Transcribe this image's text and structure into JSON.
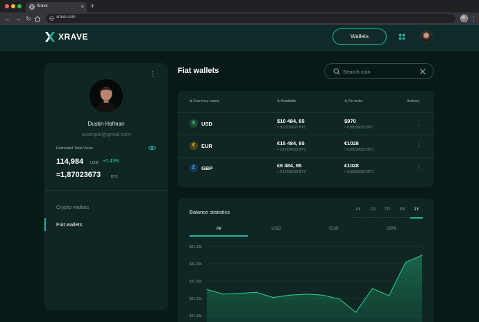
{
  "browser": {
    "tab_title": "Xrave",
    "url": "xrave.com"
  },
  "header": {
    "brand": "XRAVE",
    "wallets_button": "Wallets"
  },
  "profile": {
    "name": "Dustin Hofman",
    "email": "example@gmail.com",
    "estimated_label": "Estimated Total Value",
    "total_value": "114,984",
    "total_unit": "USD",
    "change": "+0.43%",
    "btc_value": "≈1,87023673",
    "btc_unit": "BTC"
  },
  "sidebar_nav": {
    "crypto": "Crypto wallets",
    "fiat": "Fiat wallets"
  },
  "page": {
    "title": "Fiat wallets",
    "search_placeholder": "Search coin"
  },
  "wallet_table": {
    "columns": {
      "currency": "Currency name",
      "available": "Available",
      "on_order": "On order",
      "actions": "Actions"
    },
    "rows": [
      {
        "symbol": "$",
        "code": "USD",
        "available": "$10 484, 85",
        "available_btc": "≈ 0,17230022 BTC",
        "on_order": "$970",
        "on_order_btc": "≈ 0,09230022 BTC",
        "color": "#2f8a4a"
      },
      {
        "symbol": "€",
        "code": "EUR",
        "available": "€15 484, 85",
        "available_btc": "≈ 0,17230022 BTC",
        "on_order": "€1028",
        "on_order_btc": "≈ 0,09230022 BTC",
        "color": "#c9a227"
      },
      {
        "symbol": "£",
        "code": "GBP",
        "available": "£8 484, 85",
        "available_btc": "≈ 0,17230022 BTC",
        "on_order": "£1028",
        "on_order_btc": "≈ 0,09230022 BTC",
        "color": "#2e6fb5"
      }
    ]
  },
  "stats": {
    "title": "Balance statistics",
    "ranges": [
      "All",
      "1D",
      "7D",
      "1M",
      "1Y"
    ],
    "active_range": "1Y",
    "currencies": [
      "All",
      "USD",
      "EUR",
      "GPB"
    ],
    "active_currency": "All"
  },
  "chart_data": {
    "type": "area",
    "y_tick_labels": [
      "$31,35k",
      "$31,35k",
      "$31,35k",
      "$31,35k",
      "$31,35k"
    ],
    "values": [
      0.58,
      0.48,
      0.5,
      0.52,
      0.41,
      0.46,
      0.48,
      0.46,
      0.38,
      0.1,
      0.6,
      0.45,
      1.15,
      1.3
    ],
    "ylim": [
      -0.25,
      1.5
    ],
    "line_color": "#2bd48c",
    "grid": true
  },
  "colors": {
    "accent": "#22b3a1",
    "positive": "#2bd4a0",
    "background": "#081a18",
    "card": "#0f2624"
  }
}
